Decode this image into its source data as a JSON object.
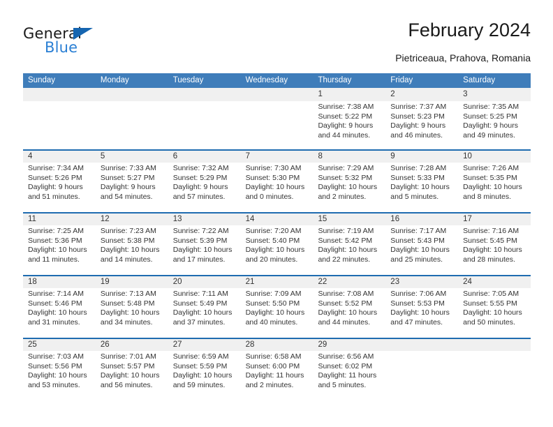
{
  "brand": {
    "name_top": "General",
    "name_bottom": "Blue",
    "triangle_color": "#1565b0",
    "blue_text_color": "#2a7fd4"
  },
  "header": {
    "title": "February 2024",
    "subtitle": "Pietriceaua, Prahova, Romania"
  },
  "theme": {
    "header_bar_color": "#3f7dba",
    "row_divider_color": "#1f6cb0",
    "daynum_band_color": "#f0f0f0",
    "text_color": "#333333"
  },
  "weekdays": [
    "Sunday",
    "Monday",
    "Tuesday",
    "Wednesday",
    "Thursday",
    "Friday",
    "Saturday"
  ],
  "weeks": [
    [
      {
        "day": "",
        "lines": []
      },
      {
        "day": "",
        "lines": []
      },
      {
        "day": "",
        "lines": []
      },
      {
        "day": "",
        "lines": []
      },
      {
        "day": "1",
        "lines": [
          "Sunrise: 7:38 AM",
          "Sunset: 5:22 PM",
          "Daylight: 9 hours",
          "and 44 minutes."
        ]
      },
      {
        "day": "2",
        "lines": [
          "Sunrise: 7:37 AM",
          "Sunset: 5:23 PM",
          "Daylight: 9 hours",
          "and 46 minutes."
        ]
      },
      {
        "day": "3",
        "lines": [
          "Sunrise: 7:35 AM",
          "Sunset: 5:25 PM",
          "Daylight: 9 hours",
          "and 49 minutes."
        ]
      }
    ],
    [
      {
        "day": "4",
        "lines": [
          "Sunrise: 7:34 AM",
          "Sunset: 5:26 PM",
          "Daylight: 9 hours",
          "and 51 minutes."
        ]
      },
      {
        "day": "5",
        "lines": [
          "Sunrise: 7:33 AM",
          "Sunset: 5:27 PM",
          "Daylight: 9 hours",
          "and 54 minutes."
        ]
      },
      {
        "day": "6",
        "lines": [
          "Sunrise: 7:32 AM",
          "Sunset: 5:29 PM",
          "Daylight: 9 hours",
          "and 57 minutes."
        ]
      },
      {
        "day": "7",
        "lines": [
          "Sunrise: 7:30 AM",
          "Sunset: 5:30 PM",
          "Daylight: 10 hours",
          "and 0 minutes."
        ]
      },
      {
        "day": "8",
        "lines": [
          "Sunrise: 7:29 AM",
          "Sunset: 5:32 PM",
          "Daylight: 10 hours",
          "and 2 minutes."
        ]
      },
      {
        "day": "9",
        "lines": [
          "Sunrise: 7:28 AM",
          "Sunset: 5:33 PM",
          "Daylight: 10 hours",
          "and 5 minutes."
        ]
      },
      {
        "day": "10",
        "lines": [
          "Sunrise: 7:26 AM",
          "Sunset: 5:35 PM",
          "Daylight: 10 hours",
          "and 8 minutes."
        ]
      }
    ],
    [
      {
        "day": "11",
        "lines": [
          "Sunrise: 7:25 AM",
          "Sunset: 5:36 PM",
          "Daylight: 10 hours",
          "and 11 minutes."
        ]
      },
      {
        "day": "12",
        "lines": [
          "Sunrise: 7:23 AM",
          "Sunset: 5:38 PM",
          "Daylight: 10 hours",
          "and 14 minutes."
        ]
      },
      {
        "day": "13",
        "lines": [
          "Sunrise: 7:22 AM",
          "Sunset: 5:39 PM",
          "Daylight: 10 hours",
          "and 17 minutes."
        ]
      },
      {
        "day": "14",
        "lines": [
          "Sunrise: 7:20 AM",
          "Sunset: 5:40 PM",
          "Daylight: 10 hours",
          "and 20 minutes."
        ]
      },
      {
        "day": "15",
        "lines": [
          "Sunrise: 7:19 AM",
          "Sunset: 5:42 PM",
          "Daylight: 10 hours",
          "and 22 minutes."
        ]
      },
      {
        "day": "16",
        "lines": [
          "Sunrise: 7:17 AM",
          "Sunset: 5:43 PM",
          "Daylight: 10 hours",
          "and 25 minutes."
        ]
      },
      {
        "day": "17",
        "lines": [
          "Sunrise: 7:16 AM",
          "Sunset: 5:45 PM",
          "Daylight: 10 hours",
          "and 28 minutes."
        ]
      }
    ],
    [
      {
        "day": "18",
        "lines": [
          "Sunrise: 7:14 AM",
          "Sunset: 5:46 PM",
          "Daylight: 10 hours",
          "and 31 minutes."
        ]
      },
      {
        "day": "19",
        "lines": [
          "Sunrise: 7:13 AM",
          "Sunset: 5:48 PM",
          "Daylight: 10 hours",
          "and 34 minutes."
        ]
      },
      {
        "day": "20",
        "lines": [
          "Sunrise: 7:11 AM",
          "Sunset: 5:49 PM",
          "Daylight: 10 hours",
          "and 37 minutes."
        ]
      },
      {
        "day": "21",
        "lines": [
          "Sunrise: 7:09 AM",
          "Sunset: 5:50 PM",
          "Daylight: 10 hours",
          "and 40 minutes."
        ]
      },
      {
        "day": "22",
        "lines": [
          "Sunrise: 7:08 AM",
          "Sunset: 5:52 PM",
          "Daylight: 10 hours",
          "and 44 minutes."
        ]
      },
      {
        "day": "23",
        "lines": [
          "Sunrise: 7:06 AM",
          "Sunset: 5:53 PM",
          "Daylight: 10 hours",
          "and 47 minutes."
        ]
      },
      {
        "day": "24",
        "lines": [
          "Sunrise: 7:05 AM",
          "Sunset: 5:55 PM",
          "Daylight: 10 hours",
          "and 50 minutes."
        ]
      }
    ],
    [
      {
        "day": "25",
        "lines": [
          "Sunrise: 7:03 AM",
          "Sunset: 5:56 PM",
          "Daylight: 10 hours",
          "and 53 minutes."
        ]
      },
      {
        "day": "26",
        "lines": [
          "Sunrise: 7:01 AM",
          "Sunset: 5:57 PM",
          "Daylight: 10 hours",
          "and 56 minutes."
        ]
      },
      {
        "day": "27",
        "lines": [
          "Sunrise: 6:59 AM",
          "Sunset: 5:59 PM",
          "Daylight: 10 hours",
          "and 59 minutes."
        ]
      },
      {
        "day": "28",
        "lines": [
          "Sunrise: 6:58 AM",
          "Sunset: 6:00 PM",
          "Daylight: 11 hours",
          "and 2 minutes."
        ]
      },
      {
        "day": "29",
        "lines": [
          "Sunrise: 6:56 AM",
          "Sunset: 6:02 PM",
          "Daylight: 11 hours",
          "and 5 minutes."
        ]
      },
      {
        "day": "",
        "lines": []
      },
      {
        "day": "",
        "lines": []
      }
    ]
  ]
}
